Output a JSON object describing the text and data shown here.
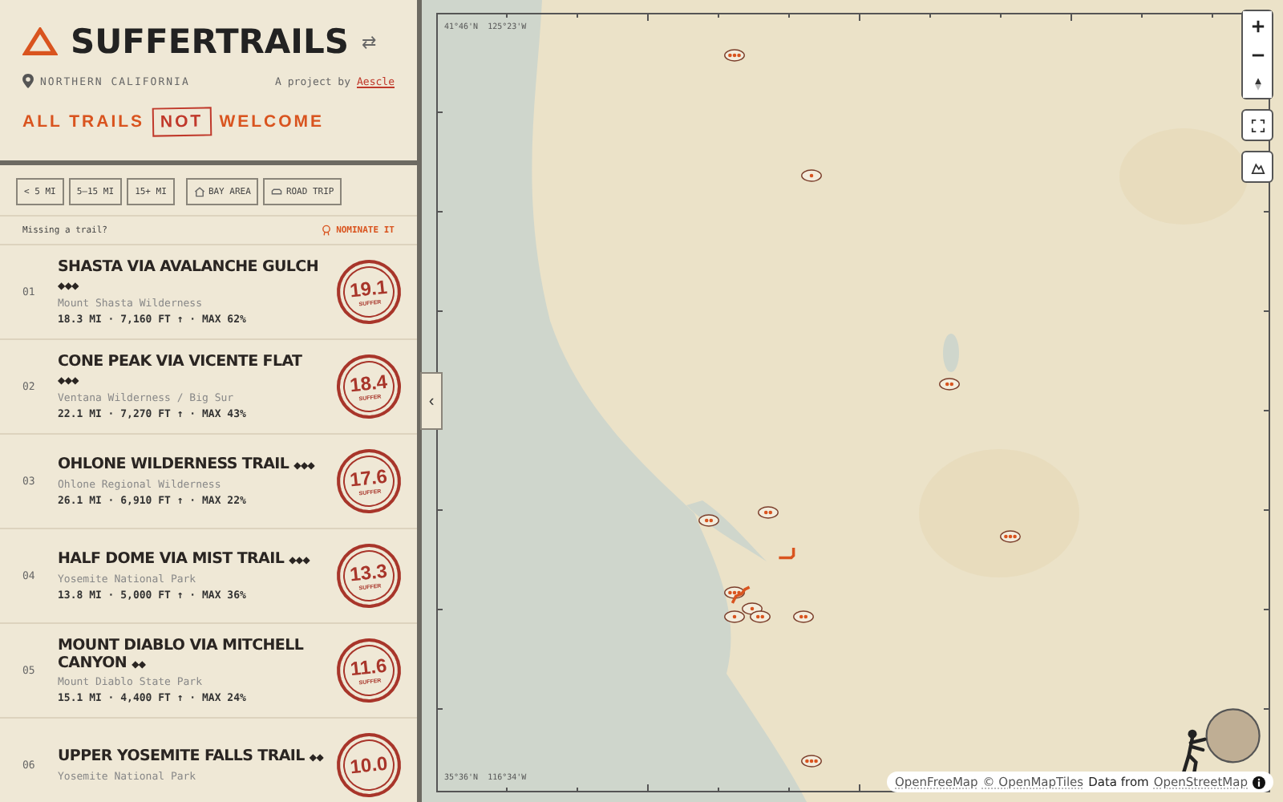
{
  "header": {
    "title": "SUFFERTRAILS",
    "swap_symbol": "⇄",
    "region": "NORTHERN CALIFORNIA",
    "credit": "A project by",
    "credit_link": "Aescle",
    "tagline": [
      {
        "text": "ALL TRAILS",
        "boxed": false
      },
      {
        "text": "NOT",
        "boxed": true
      },
      {
        "text": "WELCOME",
        "boxed": false
      }
    ]
  },
  "filters": [
    {
      "label": "< 5 MI",
      "kind": "plain",
      "selected": false
    },
    {
      "label": "5–15 MI",
      "kind": "plain",
      "selected": false
    },
    {
      "label": "15+ MI",
      "kind": "plain",
      "selected": false
    },
    {
      "label": "BAY AREA",
      "kind": "home",
      "selected": false
    },
    {
      "label": "ROAD TRIP",
      "kind": "car",
      "selected": false
    }
  ],
  "nominate": {
    "prompt": "Missing a trail?",
    "link": "NOMINATE IT"
  },
  "trails": [
    {
      "rank": "01",
      "name": "SHASTA VIA AVALANCHE GULCH",
      "difficulty": "◆◆◆",
      "area": "Mount Shasta Wilderness",
      "stats": "18.3 MI · 7,160 FT ↑ · MAX 62%",
      "score": "19.1",
      "score_label": "SUFFER"
    },
    {
      "rank": "02",
      "name": "CONE PEAK VIA VICENTE FLAT",
      "difficulty": "◆◆◆",
      "area": "Ventana Wilderness / Big Sur",
      "stats": "22.1 MI · 7,270 FT ↑ · MAX 43%",
      "score": "18.4",
      "score_label": "SUFFER"
    },
    {
      "rank": "03",
      "name": "OHLONE WILDERNESS TRAIL",
      "difficulty": "◆◆◆",
      "area": "Ohlone Regional Wilderness",
      "stats": "26.1 MI · 6,910 FT ↑ · MAX 22%",
      "score": "17.6",
      "score_label": "SUFFER"
    },
    {
      "rank": "04",
      "name": "HALF DOME VIA MIST TRAIL",
      "difficulty": "◆◆◆",
      "area": "Yosemite National Park",
      "stats": "13.8 MI · 5,000 FT ↑ · MAX 36%",
      "score": "13.3",
      "score_label": "SUFFER"
    },
    {
      "rank": "05",
      "name": "MOUNT DIABLO VIA MITCHELL CANYON",
      "difficulty": "◆◆",
      "area": "Mount Diablo State Park",
      "stats": "15.1 MI · 4,400 FT ↑ · MAX 24%",
      "score": "11.6",
      "score_label": "SUFFER"
    },
    {
      "rank": "06",
      "name": "UPPER YOSEMITE FALLS TRAIL",
      "difficulty": "◆◆",
      "area": "Yosemite National Park",
      "score": "10.0"
    }
  ],
  "collapse_symbol": "‹",
  "map": {
    "coord_top": "41°46'N  125°23'W",
    "coord_bottom": "35°36'N  116°34'W",
    "attribution": [
      {
        "text": "OpenFreeMap",
        "link": true
      },
      {
        "text": "© OpenMapTiles",
        "link": true
      },
      {
        "text": "Data from",
        "link": false
      },
      {
        "text": "OpenStreetMap",
        "link": true
      }
    ]
  }
}
